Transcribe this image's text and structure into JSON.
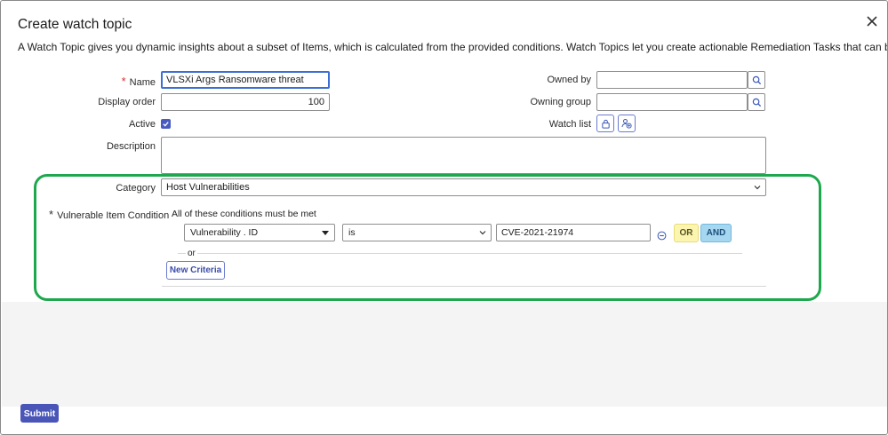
{
  "dialog": {
    "title": "Create watch topic",
    "description": "A Watch Topic gives you dynamic insights about a subset of Items, which is calculated from the provided conditions. Watch Topics let you create actionable Remediation Tasks that can be assigned for remediation.",
    "close_icon": "close-icon"
  },
  "form": {
    "name": {
      "label": "Name",
      "value": "VLSXi Args Ransomware threat",
      "required_mark": "*"
    },
    "display_order": {
      "label": "Display order",
      "value": "100"
    },
    "active": {
      "label": "Active",
      "checked": true
    },
    "description": {
      "label": "Description",
      "value": ""
    },
    "owned_by": {
      "label": "Owned by",
      "value": "",
      "icon": "search-icon"
    },
    "owning_group": {
      "label": "Owning group",
      "value": "",
      "icon": "search-icon"
    },
    "watch_list": {
      "label": "Watch list",
      "icons": [
        "lock-icon",
        "add-user-icon"
      ]
    },
    "category": {
      "label": "Category",
      "value": "Host Vulnerabilities"
    },
    "vulnerable_item_condition": {
      "label": "Vulnerable Item Condition",
      "required_mark": "*",
      "note": "All of these conditions must be met",
      "field": "Vulnerability . ID",
      "operator": "is",
      "value": "CVE-2021-21974",
      "or_label": "OR",
      "and_label": "AND",
      "or_separator": "or",
      "new_criteria_label": "New Criteria"
    }
  },
  "footer": {
    "submit_label": "Submit"
  },
  "colors": {
    "accent": "#4a55b8",
    "highlight": "#1ea84d",
    "required": "#d43131",
    "or_bg": "#fbf5b0",
    "and_bg": "#a6d7f1"
  }
}
